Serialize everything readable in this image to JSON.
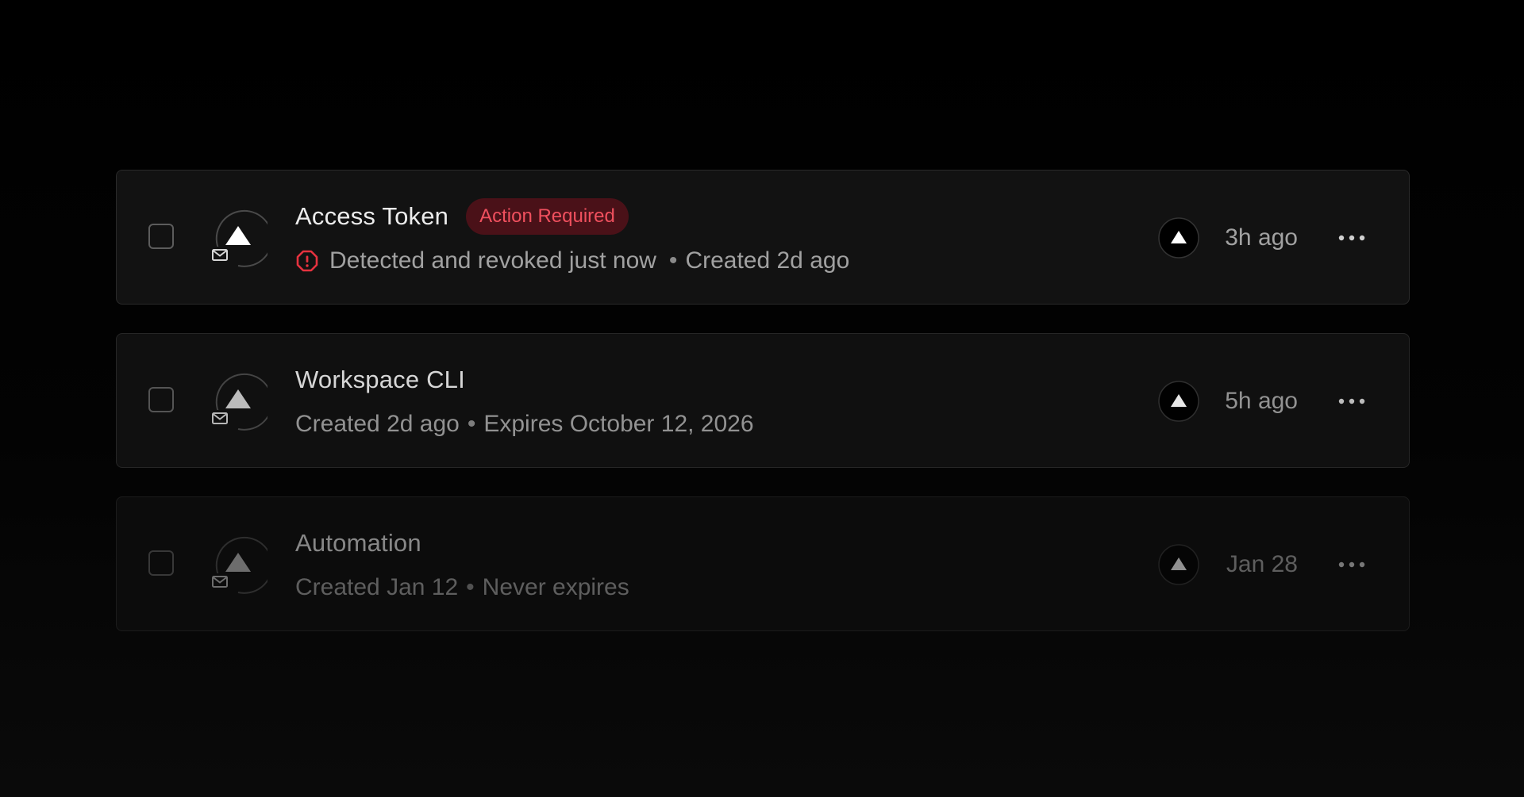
{
  "colors": {
    "background": "#000000",
    "row_background": "#111111",
    "row_border": "#262626",
    "primary_text": "#ececec",
    "secondary_text": "#a1a1a1",
    "danger": "#e5323f",
    "danger_badge_bg": "#4a1118",
    "danger_badge_text": "#f0505e"
  },
  "tokens": [
    {
      "name": "Access Token",
      "badge": "Action Required",
      "status_icon": "alert-octagon-icon",
      "status_text": "Detected and revoked just now",
      "separator": "•",
      "created": "Created 2d ago",
      "time": "3h ago",
      "avatar_icon": "triangle-logo-icon",
      "avatar_badge_icon": "mail-icon",
      "menu_icon": "ellipsis-icon"
    },
    {
      "name": "Workspace CLI",
      "created": "Created 2d ago",
      "separator": "•",
      "expires": "Expires October 12, 2026",
      "time": "5h ago",
      "avatar_icon": "triangle-logo-icon",
      "avatar_badge_icon": "mail-icon",
      "menu_icon": "ellipsis-icon"
    },
    {
      "name": "Automation",
      "created": "Created Jan 12",
      "separator": "•",
      "expires": "Never expires",
      "time": "Jan 28",
      "avatar_icon": "triangle-logo-icon",
      "avatar_badge_icon": "mail-icon",
      "menu_icon": "ellipsis-icon"
    }
  ]
}
